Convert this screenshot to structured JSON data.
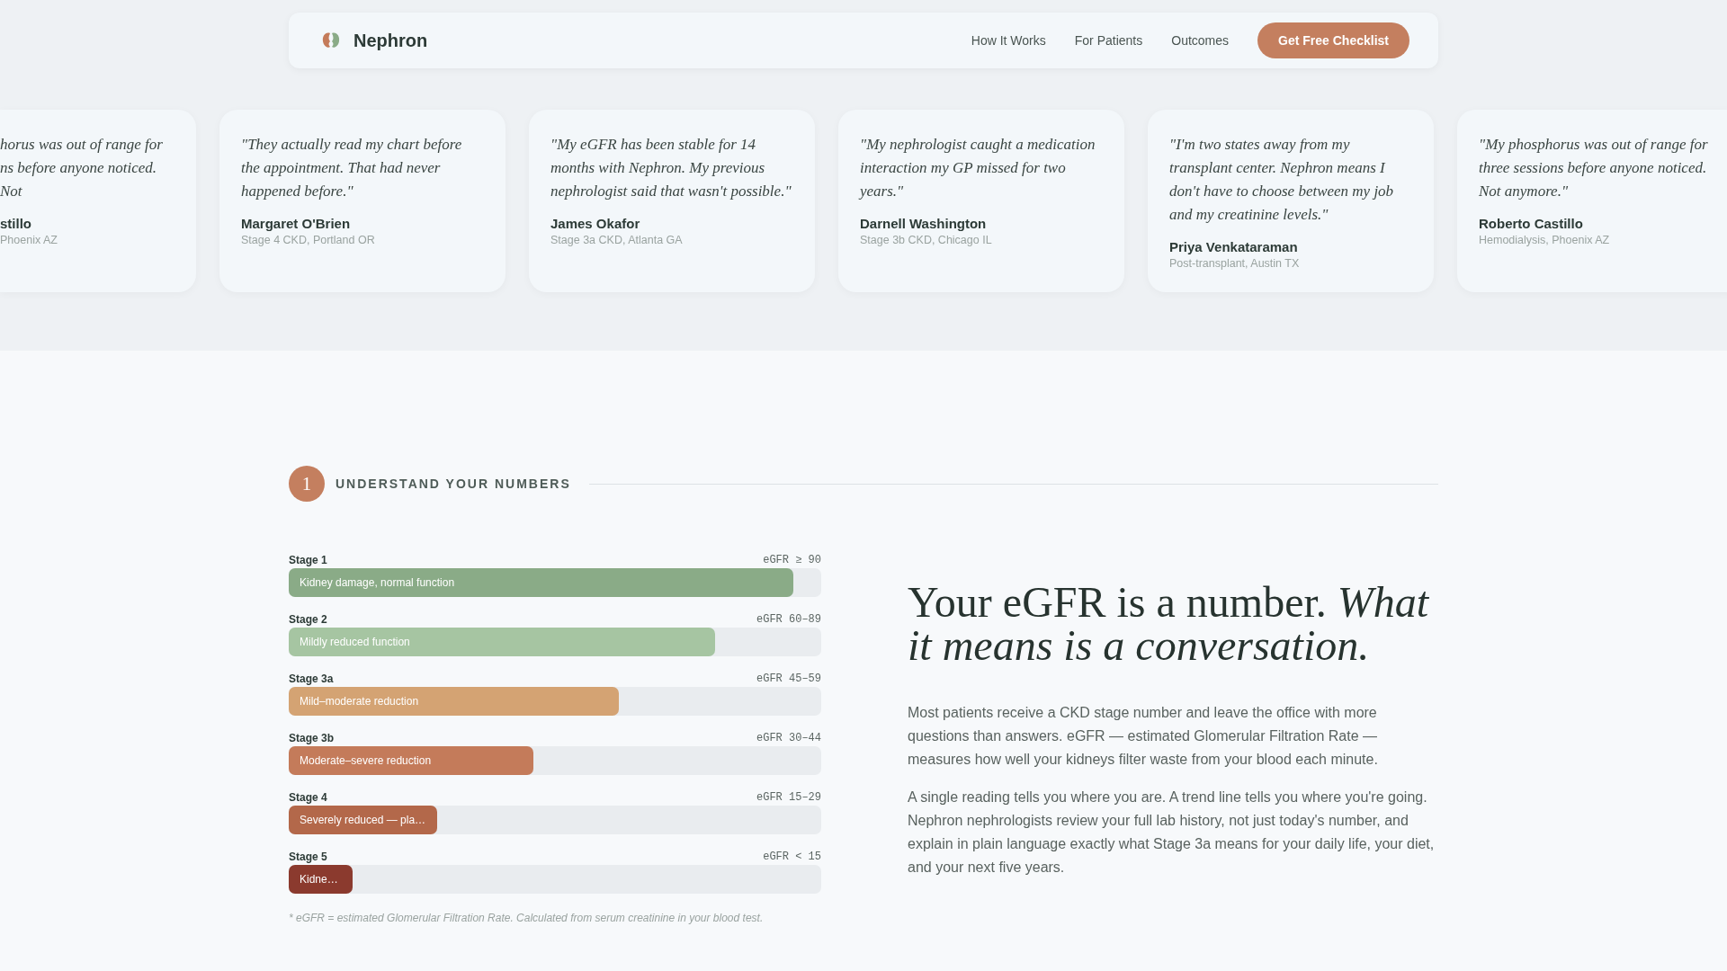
{
  "nav": {
    "brand": "Nephron",
    "links": [
      "How It Works",
      "For Patients",
      "Outcomes"
    ],
    "cta": "Get Free Checklist"
  },
  "testimonials": [
    {
      "kind": "partial",
      "quote": "horus was out of range for\nns before anyone noticed. Not",
      "name": "stillo",
      "detail": "Phoenix AZ"
    },
    {
      "kind": "full",
      "quote": "\"They actually read my chart before the appointment. That had never happened before.\"",
      "name": "Margaret O'Brien",
      "detail": "Stage 4 CKD, Portland OR"
    },
    {
      "kind": "full",
      "quote": "\"My eGFR has been stable for 14 months with Nephron. My previous nephrologist said that wasn't possible.\"",
      "name": "James Okafor",
      "detail": "Stage 3a CKD, Atlanta GA"
    },
    {
      "kind": "full",
      "quote": "\"My nephrologist caught a medication interaction my GP missed for two years.\"",
      "name": "Darnell Washington",
      "detail": "Stage 3b CKD, Chicago IL"
    },
    {
      "kind": "full",
      "quote": "\"I'm two states away from my transplant center. Nephron means I don't have to choose between my job and my creatinine levels.\"",
      "name": "Priya Venkataraman",
      "detail": "Post-transplant, Austin TX"
    },
    {
      "kind": "full",
      "quote": "\"My phosphorus was out of range for three sessions before anyone noticed. Not anymore.\"",
      "name": "Roberto Castillo",
      "detail": "Hemodialysis, Phoenix AZ"
    }
  ],
  "section": {
    "step": "1",
    "title": "UNDERSTAND YOUR NUMBERS",
    "stages": [
      {
        "name": "Stage 1",
        "range": "eGFR ≥ 90",
        "label": "Kidney damage, normal function",
        "level": 0.948,
        "color": "#8aab87"
      },
      {
        "name": "Stage 2",
        "range": "eGFR 60–89",
        "label": "Mildly reduced function",
        "level": 0.8,
        "color": "#a6c5a2"
      },
      {
        "name": "Stage 3a",
        "range": "eGFR 45–59",
        "label": "Mild–moderate reduction",
        "level": 0.62,
        "color": "#d4a373"
      },
      {
        "name": "Stage 3b",
        "range": "eGFR 30–44",
        "label": "Moderate–severe reduction",
        "level": 0.459,
        "color": "#c47b5a"
      },
      {
        "name": "Stage 4",
        "range": "eGFR 15–29",
        "label": "Severely reduced — pla…",
        "level": 0.279,
        "color": "#b3684a"
      },
      {
        "name": "Stage 5",
        "range": "eGFR < 15",
        "label": "Kidne…",
        "level": 0.12,
        "color": "#8b3a2e"
      }
    ],
    "footnote": "* eGFR = estimated Glomerular Filtration Rate. Calculated from serum creatinine in your blood test."
  },
  "intro": {
    "headline": "Your eGFR is a number. *What it means is a conversation.*",
    "paragraphs": [
      "Most patients receive a CKD stage number and leave the office with more questions than answers. eGFR — estimated Glomerular Filtration Rate — measures how well your kidneys filter waste from your blood each minute.",
      "A single reading tells you where you are. A trend line tells you where you're going. Nephron nephrologists review your full lab history, not just today's number, and explain in plain language exactly what Stage 3a means for your daily life, your diet, and your next five years."
    ]
  }
}
